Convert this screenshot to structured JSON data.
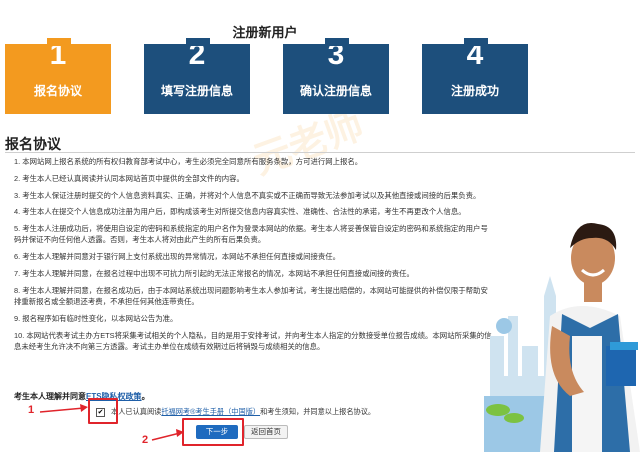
{
  "header": {
    "title": "注册新用户"
  },
  "steps": [
    {
      "num": "1",
      "label": "报名协议",
      "state": "active"
    },
    {
      "num": "2",
      "label": "填写注册信息",
      "state": "inactive"
    },
    {
      "num": "3",
      "label": "确认注册信息",
      "state": "inactive"
    },
    {
      "num": "4",
      "label": "注册成功",
      "state": "inactive"
    }
  ],
  "agreement": {
    "title": "报名协议",
    "items": [
      "1. 本网站网上报名系统的所有权归教育部考试中心，考生必须完全同意所有服务条款，方可进行网上报名。",
      "2. 考生本人已经认真阅读并认同本网站首页中提供的全部文件的内容。",
      "3. 考生本人保证注册时提交的个人信息资料真实、正确，并将对个人信息不真实或不正确而导致无法参加考试以及其他直接或间接的后果负责。",
      "4. 考生本人在提交个人信息成功注册为用户后，即构成该考生对所提交信息内容真实性、准确性、合法性的承诺，考生不再更改个人信息。",
      "5. 考生本人注册成功后，将使用自设定的密码和系统指定的用户名作为登录本网站的依据。考生本人将妥善保管自设定的密码和系统指定的用户号码并保证不向任何他人透露。否则，考生本人将对由此产生的所有后果负责。",
      "6. 考生本人理解并同意对于银行网上支付系统出现的异常情况，本网站不承担任何直接或间接责任。",
      "7. 考生本人理解并同意，在报名过程中出现不可抗力所引起的无法正常报名的情况，本网站不承担任何直接或间接的责任。",
      "8. 考生本人理解并同意，在报名成功后，由于本网站系统出现问题影响考生本人参加考试，考生提出赔偿的，本网站可能提供的补偿仅限于帮助安排重新报名或全额退还考费，不承担任何其他连带责任。",
      "9. 报名程序如有临时性变化，以本网站公告为准。",
      "10. 本网站代表考试主办方ETS将采集考试相关的个人隐私，目的是用于安排考试，并向考生本人指定的分数接受单位报告成绩。本网站所采集的信息未经考生允许决不向第三方透露。考试主办单位在成绩有效期过后将销毁与成绩相关的信息。"
    ],
    "read_hint_prefix": "考生本人理解并同意",
    "read_hint_link": "ETS隐私权政策",
    "read_hint_suffix": "。"
  },
  "consent": {
    "checkbox_mark": "✔",
    "text_prefix": "本人已认真阅读",
    "link_text": "托福网考®考生手册（中国版）",
    "text_suffix": "和考生须知，并同意以上报名协议。"
  },
  "buttons": {
    "next": "下一步",
    "back": "返回首页"
  },
  "annotations": {
    "one": "1",
    "two": "2"
  },
  "watermark": {
    "text": "元老师"
  },
  "colors": {
    "active_step": "#f39a1f",
    "inactive_step": "#1d4f7c",
    "annotation": "#e0242b",
    "primary_button": "#1f6bbf"
  }
}
